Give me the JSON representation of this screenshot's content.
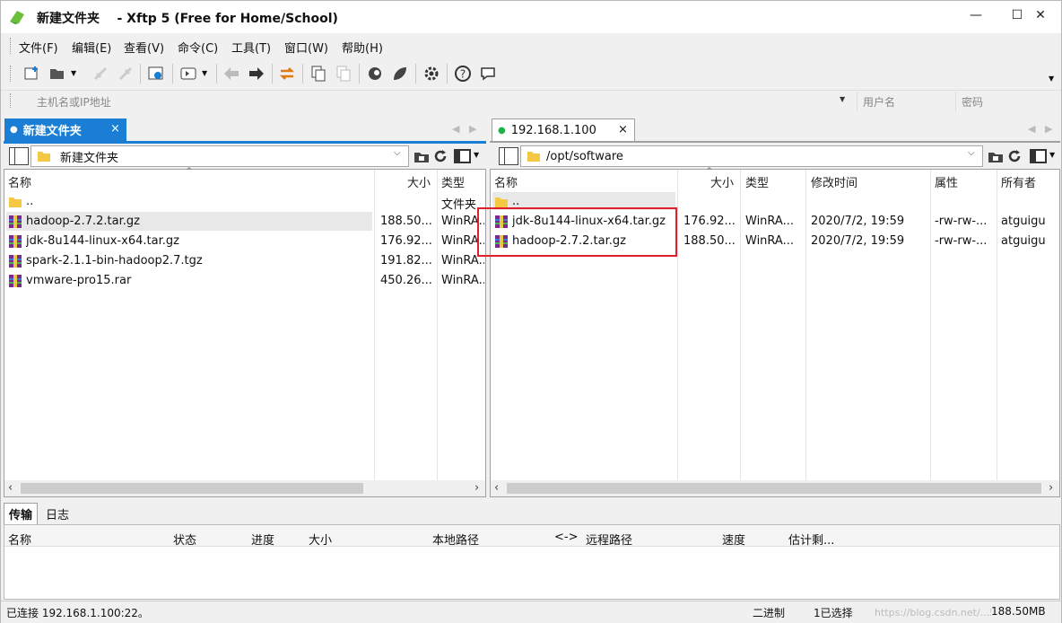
{
  "window": {
    "title_prefix": "新建文件夹",
    "title_suffix": "- Xftp 5 (Free for Home/School)",
    "minimize": "—",
    "maximize": "☐",
    "close": "✕"
  },
  "menu": [
    "文件(F)",
    "编辑(E)",
    "查看(V)",
    "命令(C)",
    "工具(T)",
    "窗口(W)",
    "帮助(H)"
  ],
  "address": {
    "host_placeholder": "主机名或IP地址",
    "user_placeholder": "用户名",
    "password_placeholder": "密码"
  },
  "left": {
    "tab": "新建文件夹",
    "tab_close": "×",
    "path": "新建文件夹",
    "columns": [
      "名称",
      "大小",
      "类型"
    ],
    "parent": "..",
    "parent_type": "文件夹",
    "files": [
      {
        "name": "hadoop-2.7.2.tar.gz",
        "size": "188.50...",
        "type": "WinRA..."
      },
      {
        "name": "jdk-8u144-linux-x64.tar.gz",
        "size": "176.92...",
        "type": "WinRA..."
      },
      {
        "name": "spark-2.1.1-bin-hadoop2.7.tgz",
        "size": "191.82...",
        "type": "WinRA..."
      },
      {
        "name": "vmware-pro15.rar",
        "size": "450.26...",
        "type": "WinRA..."
      }
    ]
  },
  "right": {
    "tab": "192.168.1.100",
    "tab_close": "×",
    "path": "/opt/software",
    "columns": [
      "名称",
      "大小",
      "类型",
      "修改时间",
      "属性",
      "所有者"
    ],
    "parent": "..",
    "files": [
      {
        "name": "jdk-8u144-linux-x64.tar.gz",
        "size": "176.92...",
        "type": "WinRA...",
        "mtime": "2020/7/2, 19:59",
        "attr": "-rw-rw-...",
        "owner": "atguigu"
      },
      {
        "name": "hadoop-2.7.2.tar.gz",
        "size": "188.50...",
        "type": "WinRA...",
        "mtime": "2020/7/2, 19:59",
        "attr": "-rw-rw-...",
        "owner": "atguigu"
      }
    ]
  },
  "transfer": {
    "tabs": [
      "传输",
      "日志"
    ],
    "columns": [
      "名称",
      "状态",
      "进度",
      "大小",
      "本地路径",
      "<->",
      "远程路径",
      "速度",
      "估计剩..."
    ]
  },
  "status": {
    "connection": "已连接 192.168.1.100:22。",
    "mode": "二进制",
    "selection": "1已选择",
    "size": "188.50MB",
    "watermark": "https://blog.csdn.net/...51CTO博客"
  },
  "colors": {
    "accent_blue": "#1a7fd4",
    "highlight_red": "#e0202a",
    "connected_green": "#21b24b",
    "selected_row": "#e8e8e8"
  }
}
